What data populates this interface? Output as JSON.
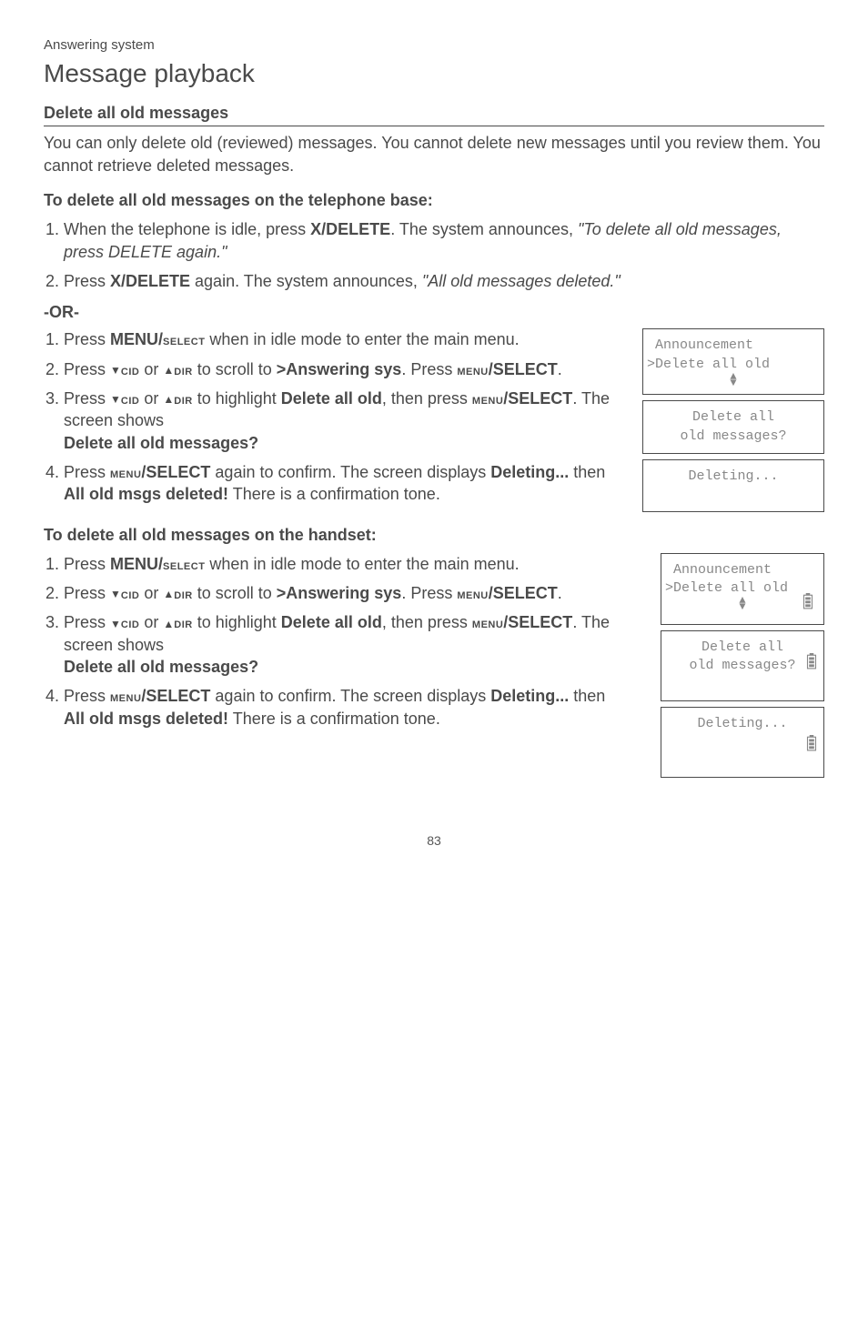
{
  "breadcrumb": "Answering system",
  "page_title": "Message playback",
  "section_title": "Delete all old messages",
  "intro": "You can only delete old (reviewed) messages. You cannot delete new messages until you review them. You cannot retrieve deleted messages.",
  "base_heading": "To delete all old messages on the telephone base:",
  "base_step1_a": "When the telephone is idle, press ",
  "base_step1_key": "X/DELETE",
  "base_step1_b": ". The system announces, ",
  "base_step1_quote": "\"To delete all old messages, press DELETE again.\"",
  "base_step2_a": "Press ",
  "base_step2_key": "X/DELETE",
  "base_step2_b": " again. The system announces, ",
  "base_step2_quote": "\"All old messages deleted.\"",
  "or_label": "-OR-",
  "menu_steps": {
    "s1_a": "Press ",
    "s1_key": "MENU/",
    "s1_sc": "SELECT",
    "s1_b": " when in idle mode to enter the main menu.",
    "s2_a": "Press ",
    "s2_cid": "CID",
    "s2_or": " or ",
    "s2_dir": "DIR",
    "s2_b": " to scroll to ",
    "s2_target": ">Answering sys",
    "s2_c": ". Press ",
    "s2_sc": "MENU",
    "s2_select": "/SELECT",
    "s2_d": ".",
    "s3_a": "Press ",
    "s3_b": " to highlight ",
    "s3_target": "Delete all old",
    "s3_c": ", then press ",
    "s3_d": ". The screen shows ",
    "s3_prompt": "Delete all old messages?",
    "s4_a": "Press ",
    "s4_b": " again to confirm. The screen displays ",
    "s4_del": "Deleting...",
    "s4_then": " then ",
    "s4_done": "All old msgs deleted!",
    "s4_c": " There is a confirmation tone."
  },
  "handset_heading": "To delete all old messages on the handset:",
  "lcd": {
    "ann_line1": " Announcement",
    "ann_line2": ">Delete all old",
    "confirm_line1": "Delete all",
    "confirm_line2": "old messages?",
    "deleting": "Deleting..."
  },
  "page_number": "83"
}
